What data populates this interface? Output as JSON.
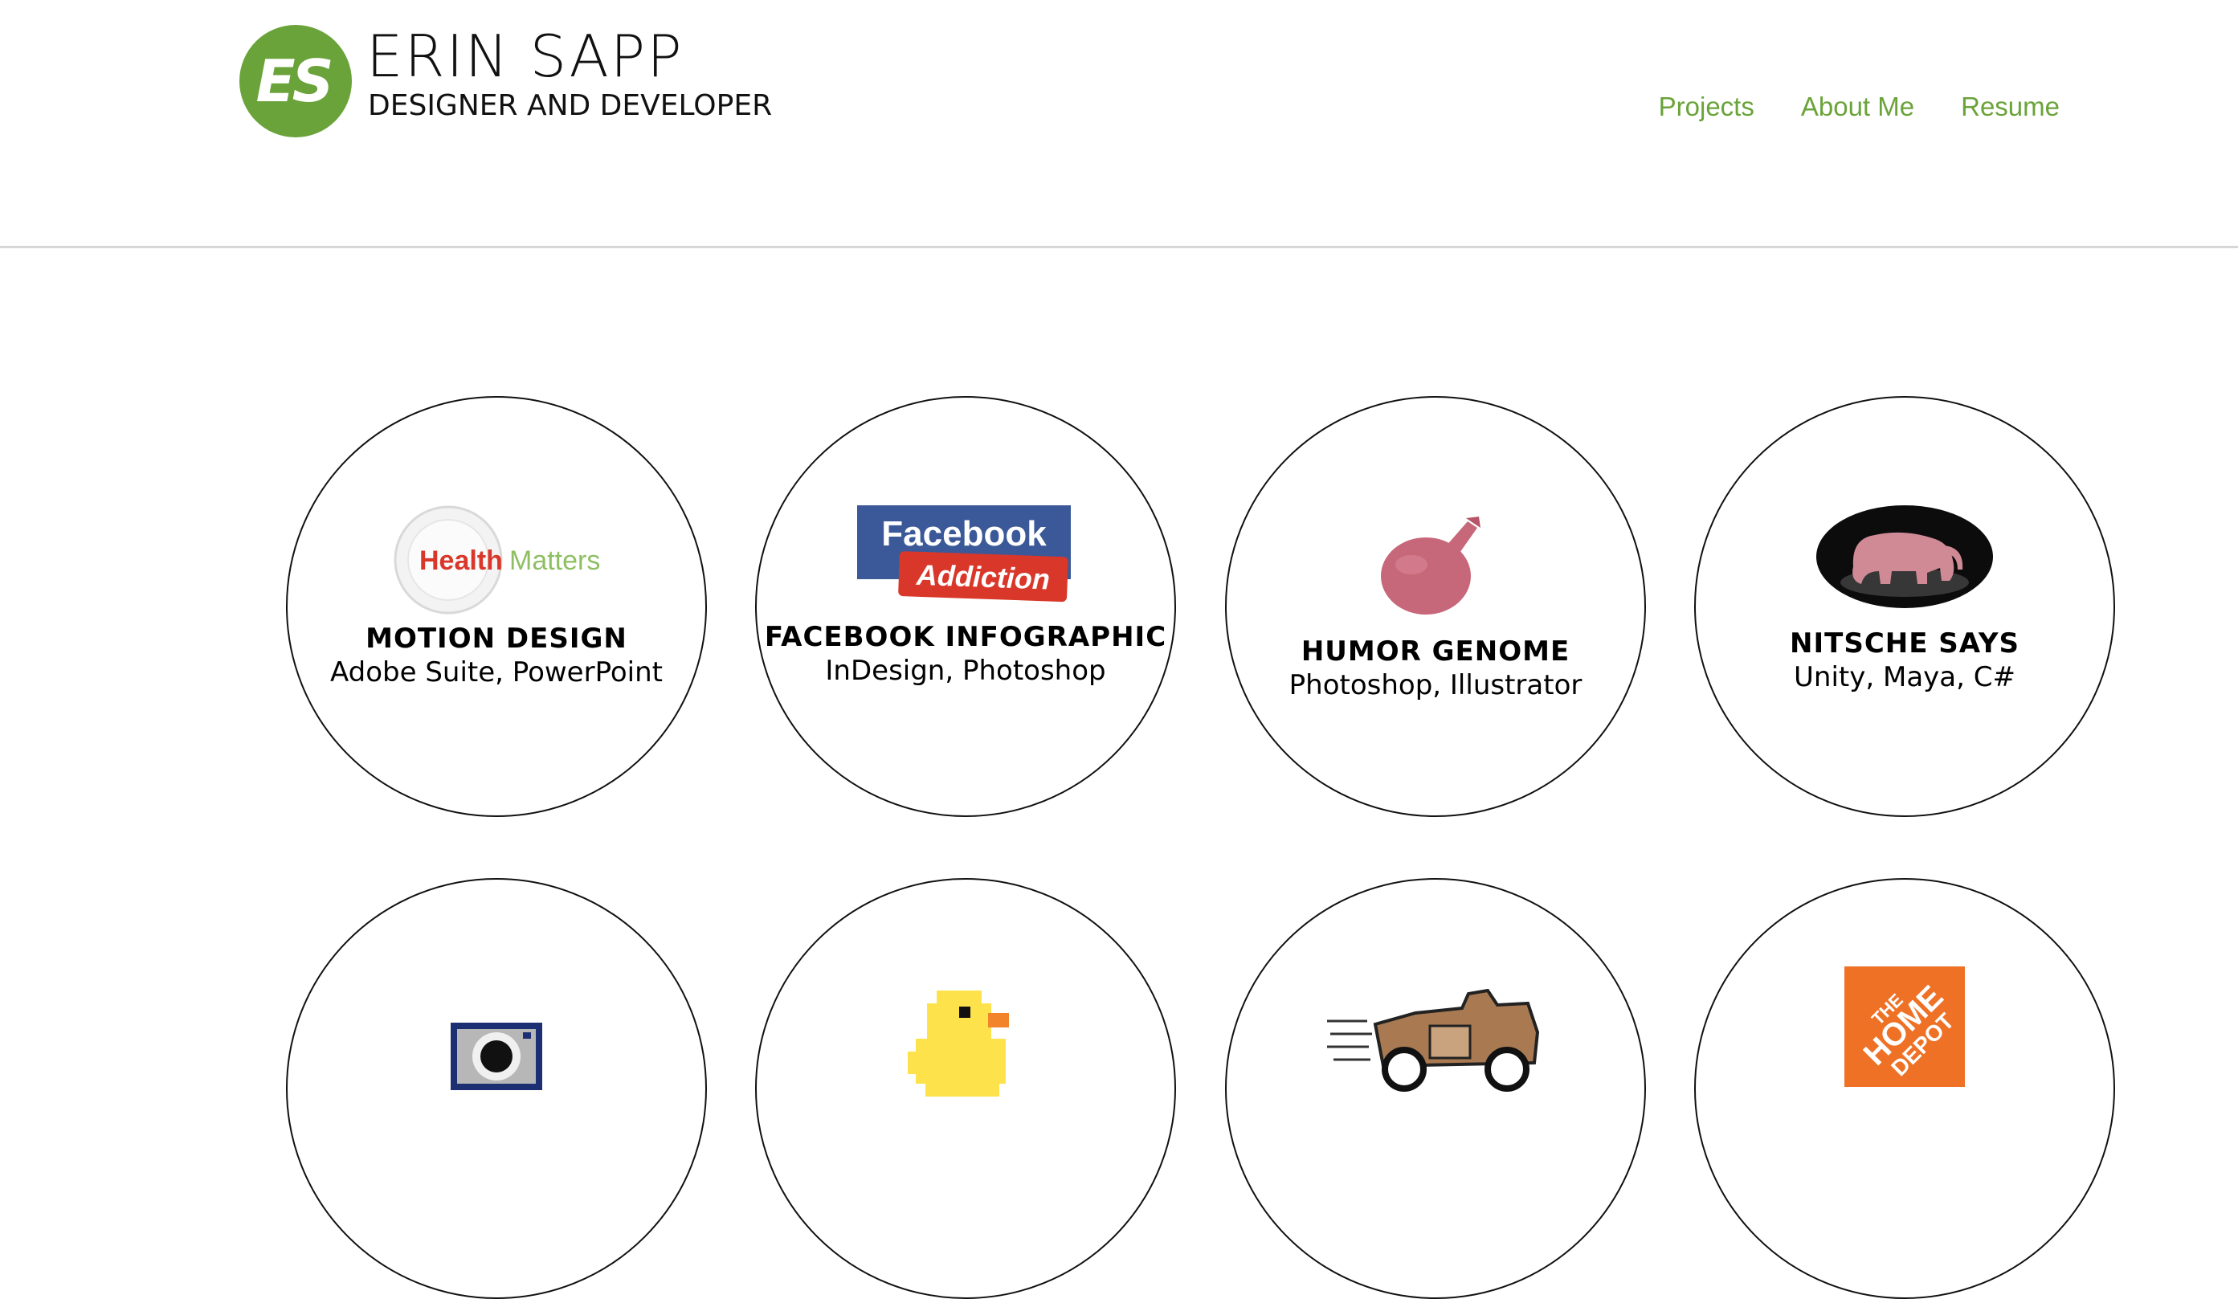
{
  "header": {
    "logo_initials": "ES",
    "name": "ERIN SAPP",
    "tagline": "DESIGNER AND DEVELOPER",
    "nav": [
      {
        "label": "Projects"
      },
      {
        "label": "About Me"
      },
      {
        "label": "Resume"
      }
    ]
  },
  "projects": [
    {
      "title": "MOTION DESIGN",
      "tools": "Adobe Suite, PowerPoint",
      "image_text_a": "Health",
      "image_text_b": "Matters",
      "icon": "plate-image"
    },
    {
      "title": "FACEBOOK INFOGRAPHIC",
      "tools": "InDesign, Photoshop",
      "image_text_a": "Facebook",
      "image_text_b": "Addiction",
      "icon": "facebook-addiction-image"
    },
    {
      "title": "HUMOR GENOME",
      "tools": "Photoshop, Illustrator",
      "icon": "whoopee-cushion-image"
    },
    {
      "title": "NITSCHE SAYS",
      "tools": "Unity, Maya, C#",
      "icon": "elephant-image"
    },
    {
      "title": "",
      "tools": "",
      "icon": "camera-image"
    },
    {
      "title": "",
      "tools": "",
      "icon": "rubber-duck-image"
    },
    {
      "title": "",
      "tools": "",
      "icon": "ramblin-wreck-car-image"
    },
    {
      "title": "",
      "tools": "",
      "icon": "home-depot-logo-image"
    }
  ],
  "colors": {
    "accent": "#6aa33a",
    "facebook_blue": "#3b5998",
    "addiction_red": "#d9372a",
    "home_depot_orange": "#ee7125",
    "duck_yellow": "#fde24b"
  }
}
